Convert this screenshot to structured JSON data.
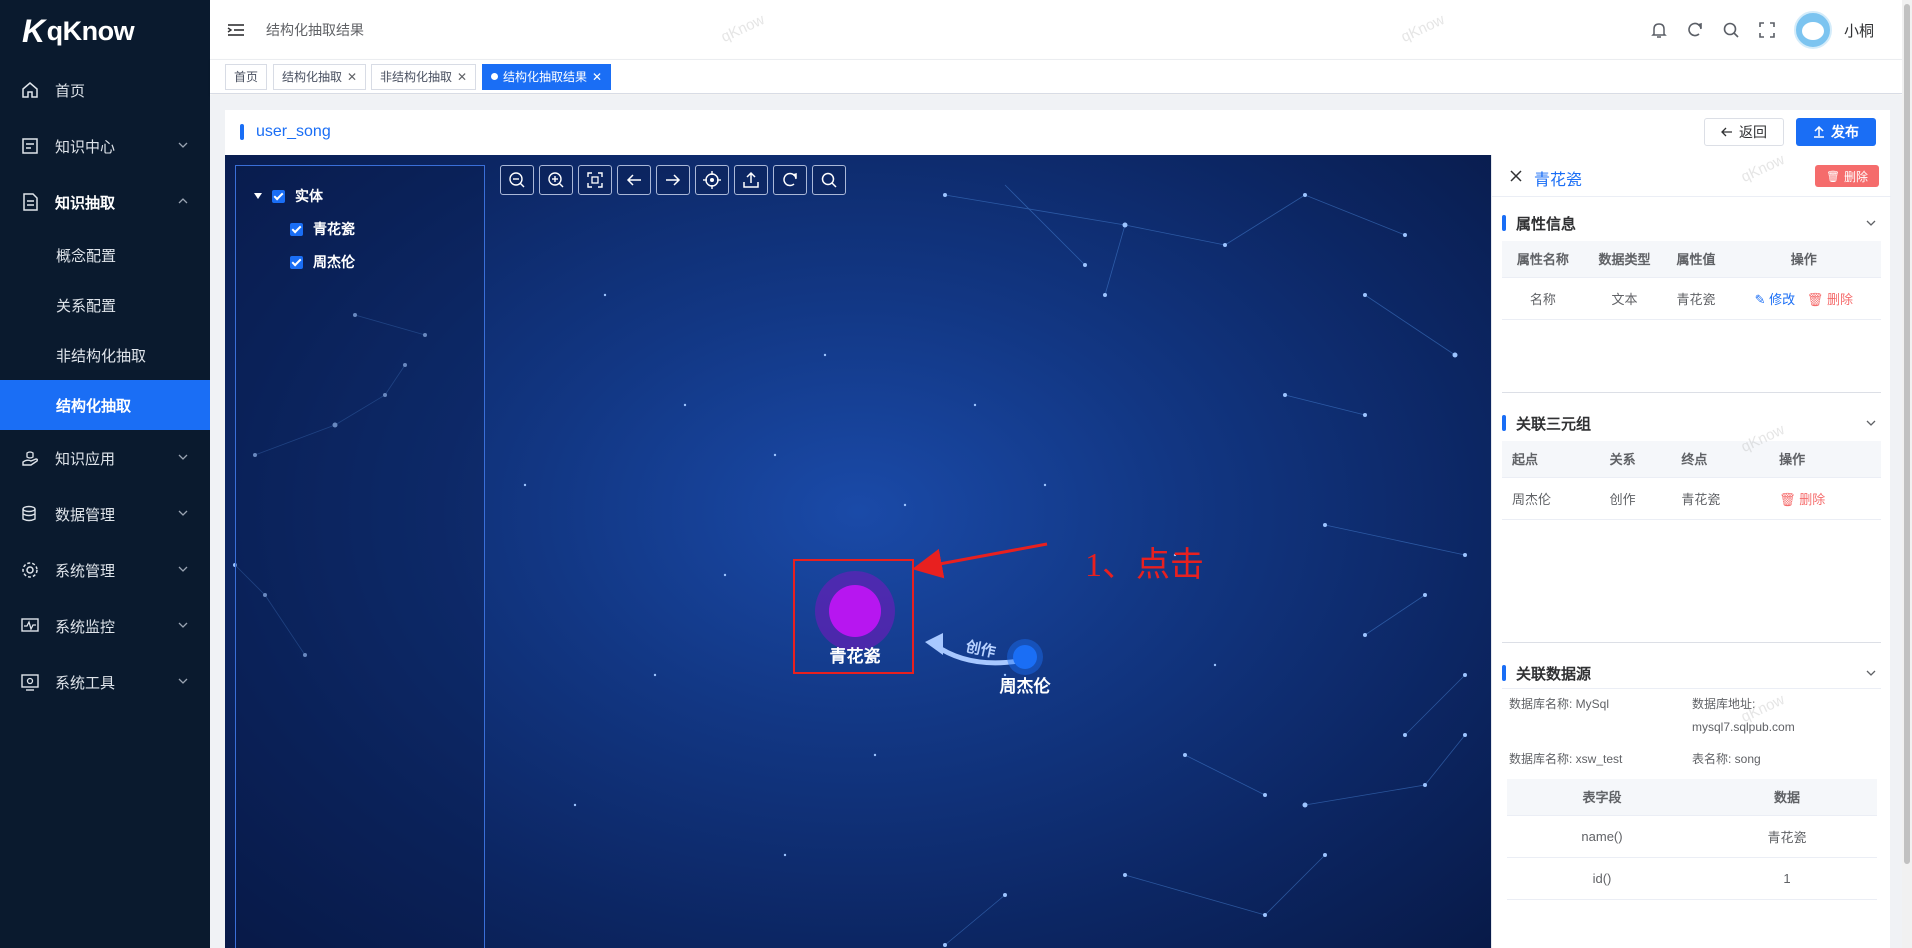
{
  "app": {
    "logo": "qKnow"
  },
  "sidebar": {
    "items": [
      {
        "label": "首页",
        "icon": "home-icon"
      },
      {
        "label": "知识中心",
        "icon": "book-icon"
      },
      {
        "label": "知识抽取",
        "icon": "document-icon",
        "expanded": true
      },
      {
        "label": "知识应用",
        "icon": "hand-icon"
      },
      {
        "label": "数据管理",
        "icon": "database-icon"
      },
      {
        "label": "系统管理",
        "icon": "gear-icon"
      },
      {
        "label": "系统监控",
        "icon": "monitor-icon"
      },
      {
        "label": "系统工具",
        "icon": "tool-icon"
      }
    ],
    "subitems": [
      {
        "label": "概念配置"
      },
      {
        "label": "关系配置"
      },
      {
        "label": "非结构化抽取"
      },
      {
        "label": "结构化抽取",
        "active": true
      }
    ]
  },
  "header": {
    "breadcrumb": "结构化抽取结果",
    "username": "小桐"
  },
  "tags": [
    {
      "label": "首页"
    },
    {
      "label": "结构化抽取"
    },
    {
      "label": "非结构化抽取"
    },
    {
      "label": "结构化抽取结果",
      "active": true
    }
  ],
  "page": {
    "title": "user_song",
    "back_label": "返回",
    "publish_label": "发布"
  },
  "tree": {
    "root": "实体",
    "children": [
      {
        "label": "青花瓷",
        "checked": true
      },
      {
        "label": "周杰伦",
        "checked": true
      }
    ]
  },
  "graph": {
    "nodes": [
      {
        "label": "青花瓷",
        "color": "#b716f0"
      },
      {
        "label": "周杰伦",
        "color": "#1a6ef5"
      }
    ],
    "edge_label": "创作",
    "annotation": "1、点击"
  },
  "panel": {
    "entity_name": "青花瓷",
    "delete_label": "删除",
    "attr_section": {
      "title": "属性信息",
      "columns": [
        "属性名称",
        "数据类型",
        "属性值",
        "操作"
      ],
      "rows": [
        {
          "name": "名称",
          "type": "文本",
          "value": "青花瓷",
          "edit": "修改",
          "del": "删除"
        }
      ]
    },
    "triple_section": {
      "title": "关联三元组",
      "columns": [
        "起点",
        "关系",
        "终点",
        "操作"
      ],
      "rows": [
        {
          "start": "周杰伦",
          "rel": "创作",
          "end": "青花瓷",
          "del": "删除"
        }
      ]
    },
    "source_section": {
      "title": "关联数据源",
      "db_name_1": "数据库名称: MySql",
      "db_addr_label": "数据库地址:",
      "db_addr_value": "mysql7.sqlpub.com",
      "db_name_2": "数据库名称: xsw_test",
      "table_name": "表名称: song",
      "columns": [
        "表字段",
        "数据"
      ],
      "rows": [
        {
          "field": "name()",
          "data": "青花瓷"
        },
        {
          "field": "id()",
          "data": "1"
        }
      ]
    }
  },
  "watermark": "qKnow"
}
